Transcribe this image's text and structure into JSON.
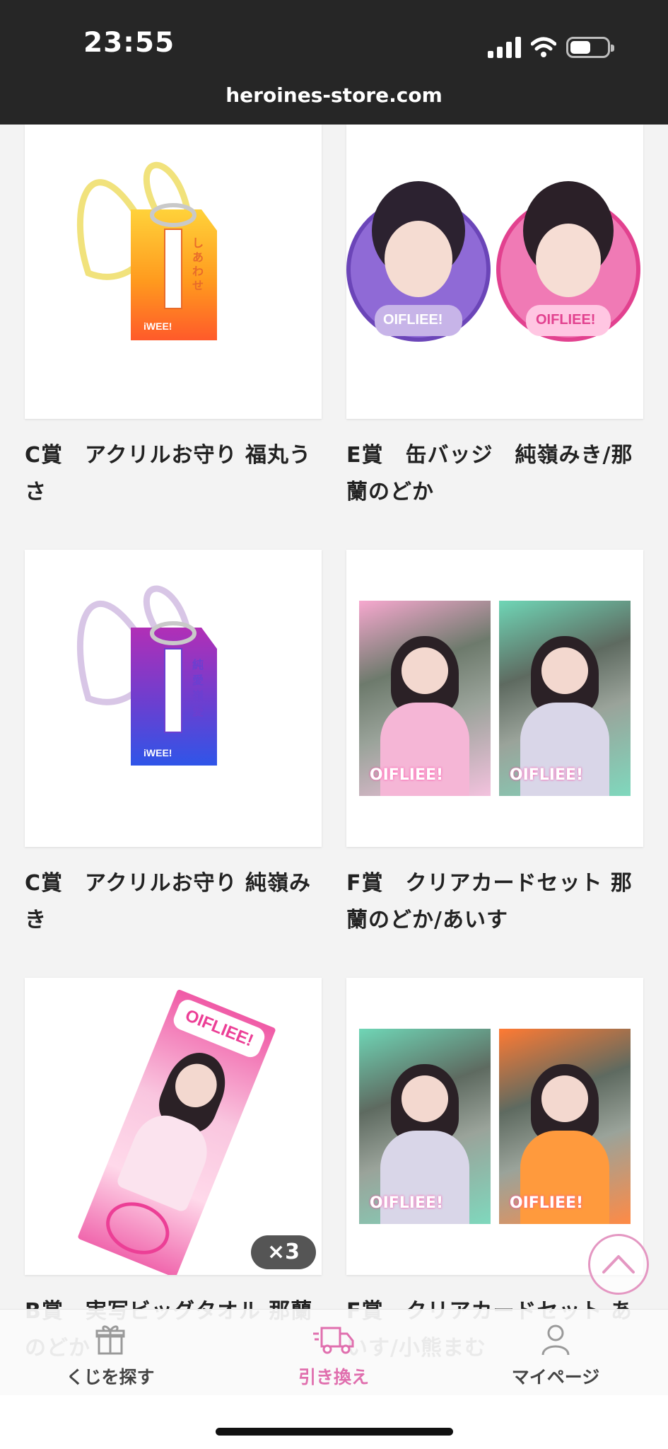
{
  "status_bar": {
    "time": "23:55",
    "url": "heroines-store.com"
  },
  "products": [
    {
      "title": "C賞　アクリルお守り 福丸うさ",
      "image": "amulet-orange",
      "charm_text": "しあわせ"
    },
    {
      "title": "E賞　缶バッジ　純嶺みき/那蘭のどか",
      "image": "can-badges"
    },
    {
      "title": "C賞　アクリルお守り 純嶺みき",
      "image": "amulet-purple",
      "charm_text": "純愛嶺愛"
    },
    {
      "title": "F賞　クリアカードセット 那蘭のどか/あいす",
      "image": "clear-cards-pink-mint"
    },
    {
      "title": "B賞　実写ビッグタオル 那蘭のどか",
      "image": "big-towel",
      "quantity_badge": "×3"
    },
    {
      "title": "F賞　クリアカードセット あいす/小熊まむ",
      "image": "clear-cards-mint-orange"
    }
  ],
  "tab_bar": {
    "tabs": [
      {
        "label": "くじを探す",
        "icon": "gift-icon"
      },
      {
        "label": "引き換え",
        "icon": "delivery-truck-icon",
        "active": true
      },
      {
        "label": "マイページ",
        "icon": "user-icon"
      }
    ]
  },
  "colors": {
    "accent": "#e06fae",
    "status_bar_bg": "#262626",
    "page_bg": "#f3f3f3"
  }
}
